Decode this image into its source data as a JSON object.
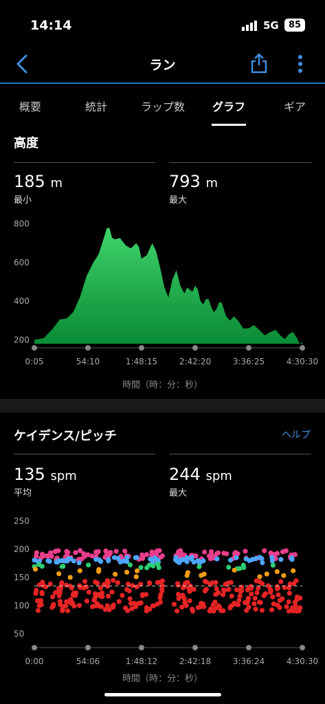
{
  "status": {
    "time": "14:14",
    "network": "5G",
    "battery": "85"
  },
  "nav": {
    "title": "ラン"
  },
  "tabs": [
    "概要",
    "統計",
    "ラップ数",
    "グラフ",
    "ギア"
  ],
  "elevation": {
    "title": "高度",
    "min_value": "185",
    "min_unit": "m",
    "min_label": "最小",
    "max_value": "793",
    "max_unit": "m",
    "max_label": "最大",
    "axis_label": "時間（時：分：秒）"
  },
  "cadence": {
    "title": "ケイデンス/ピッチ",
    "help": "ヘルプ",
    "avg_value": "135",
    "avg_unit": "spm",
    "avg_label": "平均",
    "max_value": "244",
    "max_unit": "spm",
    "max_label": "最大",
    "axis_label": "時間（時：分：秒）"
  },
  "chart_data": [
    {
      "type": "area",
      "title": "高度",
      "y_ticks": [
        200,
        400,
        600,
        800
      ],
      "ylim": [
        180,
        820
      ],
      "x_ticks": [
        "0:05",
        "54:10",
        "1:48:15",
        "2:42:20",
        "3:36:25",
        "4:30:30"
      ],
      "x": [
        0,
        0.07,
        0.12,
        0.17,
        0.22,
        0.26,
        0.28,
        0.3,
        0.34,
        0.38,
        0.4,
        0.44,
        0.47,
        0.5,
        0.53,
        0.56,
        0.58,
        0.6,
        0.62,
        0.64,
        0.66,
        0.68,
        0.7,
        0.73,
        0.76,
        0.8,
        0.84,
        0.88,
        0.92,
        0.95,
        0.98,
        1.0
      ],
      "y": [
        200,
        260,
        310,
        420,
        600,
        730,
        780,
        720,
        690,
        700,
        620,
        700,
        570,
        420,
        560,
        440,
        460,
        480,
        400,
        410,
        370,
        360,
        390,
        300,
        300,
        260,
        250,
        240,
        220,
        230,
        210,
        190
      ],
      "color": "#1db954"
    },
    {
      "type": "scatter",
      "title": "ケイデンス/ピッチ",
      "y_ticks": [
        50,
        100,
        150,
        200,
        250
      ],
      "ylim": [
        40,
        260
      ],
      "x_ticks": [
        "0:00",
        "54:06",
        "1:48:12",
        "2:42:18",
        "3:36:24",
        "4:30:30"
      ],
      "reference_line": 135,
      "series": [
        {
          "color": "#e83e8c",
          "band": [
            182,
            198
          ]
        },
        {
          "color": "#4da6ff",
          "band": [
            176,
            186
          ]
        },
        {
          "color": "#2ecc71",
          "band": [
            165,
            175
          ]
        },
        {
          "color": "#f39c12",
          "band": [
            150,
            165
          ]
        },
        {
          "color": "#e62424",
          "band": [
            90,
            145
          ]
        }
      ]
    }
  ]
}
